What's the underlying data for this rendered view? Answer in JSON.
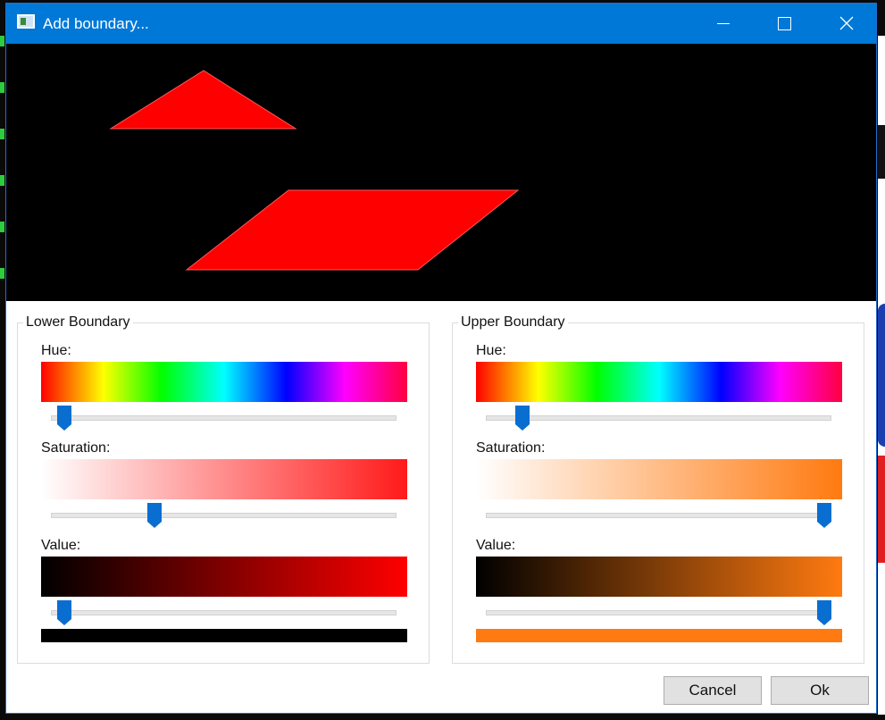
{
  "window": {
    "title": "Add boundary...",
    "icons": {
      "app": "app-window-icon",
      "minimize": "minimize-icon",
      "maximize": "maximize-icon",
      "close": "close-icon"
    }
  },
  "preview": {
    "background": "#000000",
    "shape_color": "#ff0000"
  },
  "lower": {
    "title": "Lower Boundary",
    "hue_label": "Hue:",
    "saturation_label": "Saturation:",
    "value_label": "Value:",
    "hue": 0.02,
    "saturation": 0.29,
    "value": 0.02,
    "saturation_gradient": [
      "#ffffff",
      "#ff1a1a"
    ],
    "value_gradient": [
      "#000000",
      "#ff0000"
    ],
    "swatch_color": "#000000"
  },
  "upper": {
    "title": "Upper Boundary",
    "hue_label": "Hue:",
    "saturation_label": "Saturation:",
    "value_label": "Value:",
    "hue": 0.09,
    "saturation": 1.0,
    "value": 1.0,
    "saturation_gradient": [
      "#ffffff",
      "#ff7a10"
    ],
    "value_gradient": [
      "#000000",
      "#ff7a10"
    ],
    "swatch_color": "#ff7a10"
  },
  "buttons": {
    "cancel": "Cancel",
    "ok": "Ok"
  },
  "colors": {
    "titlebar": "#0078d7",
    "slider_thumb": "#0a6ed1"
  }
}
